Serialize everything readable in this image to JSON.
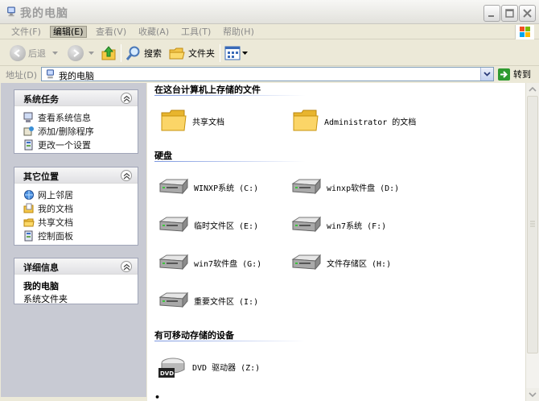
{
  "window": {
    "title": "我的电脑"
  },
  "menu": [
    {
      "label": "文件(F)",
      "active": false
    },
    {
      "label": "编辑(E)",
      "active": true
    },
    {
      "label": "查看(V)",
      "active": false
    },
    {
      "label": "收藏(A)",
      "active": false
    },
    {
      "label": "工具(T)",
      "active": false
    },
    {
      "label": "帮助(H)",
      "active": false
    }
  ],
  "toolbar": {
    "back_label": "后退",
    "search_label": "搜索",
    "folders_label": "文件夹"
  },
  "address": {
    "label": "地址(D)",
    "value": "我的电脑",
    "go_label": "转到"
  },
  "sidebar": {
    "system_tasks": {
      "title": "系统任务",
      "items": [
        "查看系统信息",
        "添加/删除程序",
        "更改一个设置"
      ]
    },
    "other_places": {
      "title": "其它位置",
      "items": [
        "网上邻居",
        "我的文档",
        "共享文档",
        "控制面板"
      ]
    },
    "details": {
      "title": "详细信息",
      "name": "我的电脑",
      "type": "系统文件夹"
    }
  },
  "content": {
    "stored_files_header": "在这台计算机上存储的文件",
    "stored_files": [
      "共享文档",
      "Administrator 的文档"
    ],
    "hard_drives_header": "硬盘",
    "hard_drives": [
      "WINXP系统 (C:)",
      "winxp软件盘 (D:)",
      "临时文件区 (E:)",
      "win7系统 (F:)",
      "win7软件盘 (G:)",
      "文件存储区 (H:)",
      "重要文件区 (I:)"
    ],
    "removable_header": "有可移动存储的设备",
    "removable": [
      "DVD 驱动器 (Z:)"
    ],
    "dvd_badge": "DVD"
  },
  "colors": {
    "sidebar_bg": "#c8cad3",
    "header_line": "#7a96df",
    "window_bg": "#ece9d8"
  }
}
